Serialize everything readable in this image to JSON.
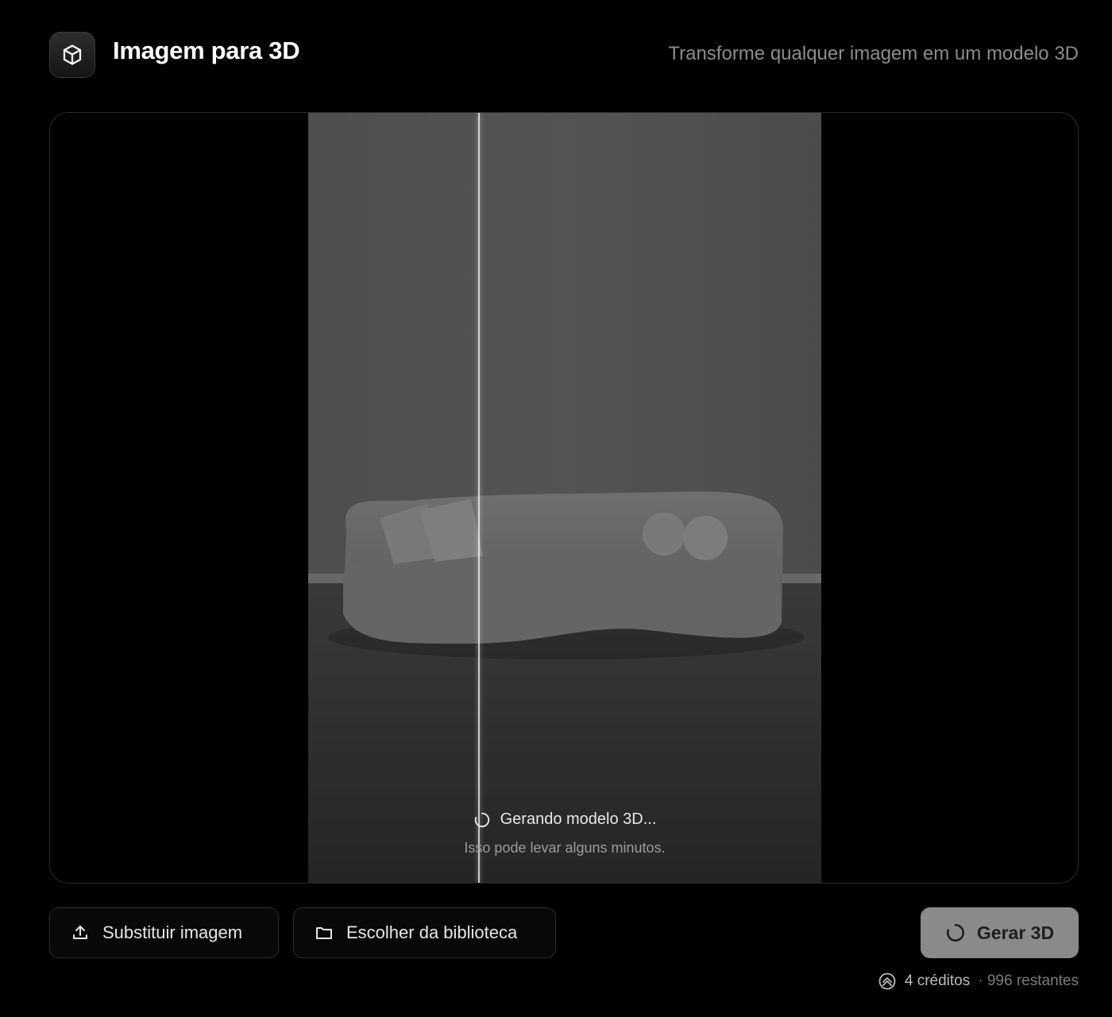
{
  "header": {
    "icon": "cube-icon",
    "title": "Imagem para 3D",
    "subtitle": "Transforme qualquer imagem em um modelo 3D"
  },
  "viewer": {
    "status_icon": "spinner-icon",
    "status_title": "Gerando modelo 3D...",
    "status_subtitle": "Isso pode levar alguns minutos."
  },
  "actions": {
    "replace_icon": "upload-icon",
    "replace_label": "Substituir imagem",
    "library_icon": "folder-icon",
    "library_label": "Escolher da biblioteca",
    "generate_icon": "spinner-icon",
    "generate_label": "Gerar 3D"
  },
  "credits": {
    "icon": "credits-icon",
    "amount": "4 créditos",
    "remaining": "· 996 restantes"
  },
  "colors": {
    "background": "#000000",
    "generate_button": "#8a8a8a",
    "muted_text": "#8c8c8c"
  }
}
